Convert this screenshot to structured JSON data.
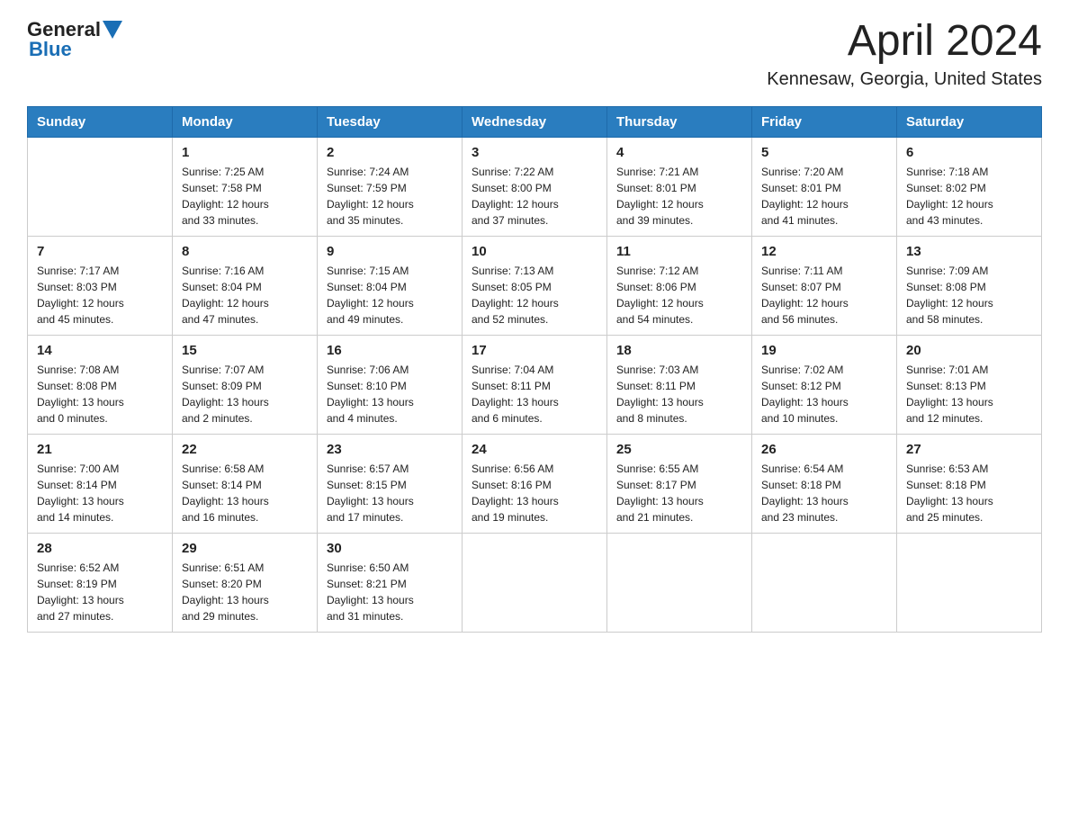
{
  "header": {
    "logo_general": "General",
    "logo_blue": "Blue",
    "title": "April 2024",
    "subtitle": "Kennesaw, Georgia, United States"
  },
  "days_of_week": [
    "Sunday",
    "Monday",
    "Tuesday",
    "Wednesday",
    "Thursday",
    "Friday",
    "Saturday"
  ],
  "weeks": [
    [
      {
        "day": "",
        "info": ""
      },
      {
        "day": "1",
        "info": "Sunrise: 7:25 AM\nSunset: 7:58 PM\nDaylight: 12 hours\nand 33 minutes."
      },
      {
        "day": "2",
        "info": "Sunrise: 7:24 AM\nSunset: 7:59 PM\nDaylight: 12 hours\nand 35 minutes."
      },
      {
        "day": "3",
        "info": "Sunrise: 7:22 AM\nSunset: 8:00 PM\nDaylight: 12 hours\nand 37 minutes."
      },
      {
        "day": "4",
        "info": "Sunrise: 7:21 AM\nSunset: 8:01 PM\nDaylight: 12 hours\nand 39 minutes."
      },
      {
        "day": "5",
        "info": "Sunrise: 7:20 AM\nSunset: 8:01 PM\nDaylight: 12 hours\nand 41 minutes."
      },
      {
        "day": "6",
        "info": "Sunrise: 7:18 AM\nSunset: 8:02 PM\nDaylight: 12 hours\nand 43 minutes."
      }
    ],
    [
      {
        "day": "7",
        "info": "Sunrise: 7:17 AM\nSunset: 8:03 PM\nDaylight: 12 hours\nand 45 minutes."
      },
      {
        "day": "8",
        "info": "Sunrise: 7:16 AM\nSunset: 8:04 PM\nDaylight: 12 hours\nand 47 minutes."
      },
      {
        "day": "9",
        "info": "Sunrise: 7:15 AM\nSunset: 8:04 PM\nDaylight: 12 hours\nand 49 minutes."
      },
      {
        "day": "10",
        "info": "Sunrise: 7:13 AM\nSunset: 8:05 PM\nDaylight: 12 hours\nand 52 minutes."
      },
      {
        "day": "11",
        "info": "Sunrise: 7:12 AM\nSunset: 8:06 PM\nDaylight: 12 hours\nand 54 minutes."
      },
      {
        "day": "12",
        "info": "Sunrise: 7:11 AM\nSunset: 8:07 PM\nDaylight: 12 hours\nand 56 minutes."
      },
      {
        "day": "13",
        "info": "Sunrise: 7:09 AM\nSunset: 8:08 PM\nDaylight: 12 hours\nand 58 minutes."
      }
    ],
    [
      {
        "day": "14",
        "info": "Sunrise: 7:08 AM\nSunset: 8:08 PM\nDaylight: 13 hours\nand 0 minutes."
      },
      {
        "day": "15",
        "info": "Sunrise: 7:07 AM\nSunset: 8:09 PM\nDaylight: 13 hours\nand 2 minutes."
      },
      {
        "day": "16",
        "info": "Sunrise: 7:06 AM\nSunset: 8:10 PM\nDaylight: 13 hours\nand 4 minutes."
      },
      {
        "day": "17",
        "info": "Sunrise: 7:04 AM\nSunset: 8:11 PM\nDaylight: 13 hours\nand 6 minutes."
      },
      {
        "day": "18",
        "info": "Sunrise: 7:03 AM\nSunset: 8:11 PM\nDaylight: 13 hours\nand 8 minutes."
      },
      {
        "day": "19",
        "info": "Sunrise: 7:02 AM\nSunset: 8:12 PM\nDaylight: 13 hours\nand 10 minutes."
      },
      {
        "day": "20",
        "info": "Sunrise: 7:01 AM\nSunset: 8:13 PM\nDaylight: 13 hours\nand 12 minutes."
      }
    ],
    [
      {
        "day": "21",
        "info": "Sunrise: 7:00 AM\nSunset: 8:14 PM\nDaylight: 13 hours\nand 14 minutes."
      },
      {
        "day": "22",
        "info": "Sunrise: 6:58 AM\nSunset: 8:14 PM\nDaylight: 13 hours\nand 16 minutes."
      },
      {
        "day": "23",
        "info": "Sunrise: 6:57 AM\nSunset: 8:15 PM\nDaylight: 13 hours\nand 17 minutes."
      },
      {
        "day": "24",
        "info": "Sunrise: 6:56 AM\nSunset: 8:16 PM\nDaylight: 13 hours\nand 19 minutes."
      },
      {
        "day": "25",
        "info": "Sunrise: 6:55 AM\nSunset: 8:17 PM\nDaylight: 13 hours\nand 21 minutes."
      },
      {
        "day": "26",
        "info": "Sunrise: 6:54 AM\nSunset: 8:18 PM\nDaylight: 13 hours\nand 23 minutes."
      },
      {
        "day": "27",
        "info": "Sunrise: 6:53 AM\nSunset: 8:18 PM\nDaylight: 13 hours\nand 25 minutes."
      }
    ],
    [
      {
        "day": "28",
        "info": "Sunrise: 6:52 AM\nSunset: 8:19 PM\nDaylight: 13 hours\nand 27 minutes."
      },
      {
        "day": "29",
        "info": "Sunrise: 6:51 AM\nSunset: 8:20 PM\nDaylight: 13 hours\nand 29 minutes."
      },
      {
        "day": "30",
        "info": "Sunrise: 6:50 AM\nSunset: 8:21 PM\nDaylight: 13 hours\nand 31 minutes."
      },
      {
        "day": "",
        "info": ""
      },
      {
        "day": "",
        "info": ""
      },
      {
        "day": "",
        "info": ""
      },
      {
        "day": "",
        "info": ""
      }
    ]
  ]
}
